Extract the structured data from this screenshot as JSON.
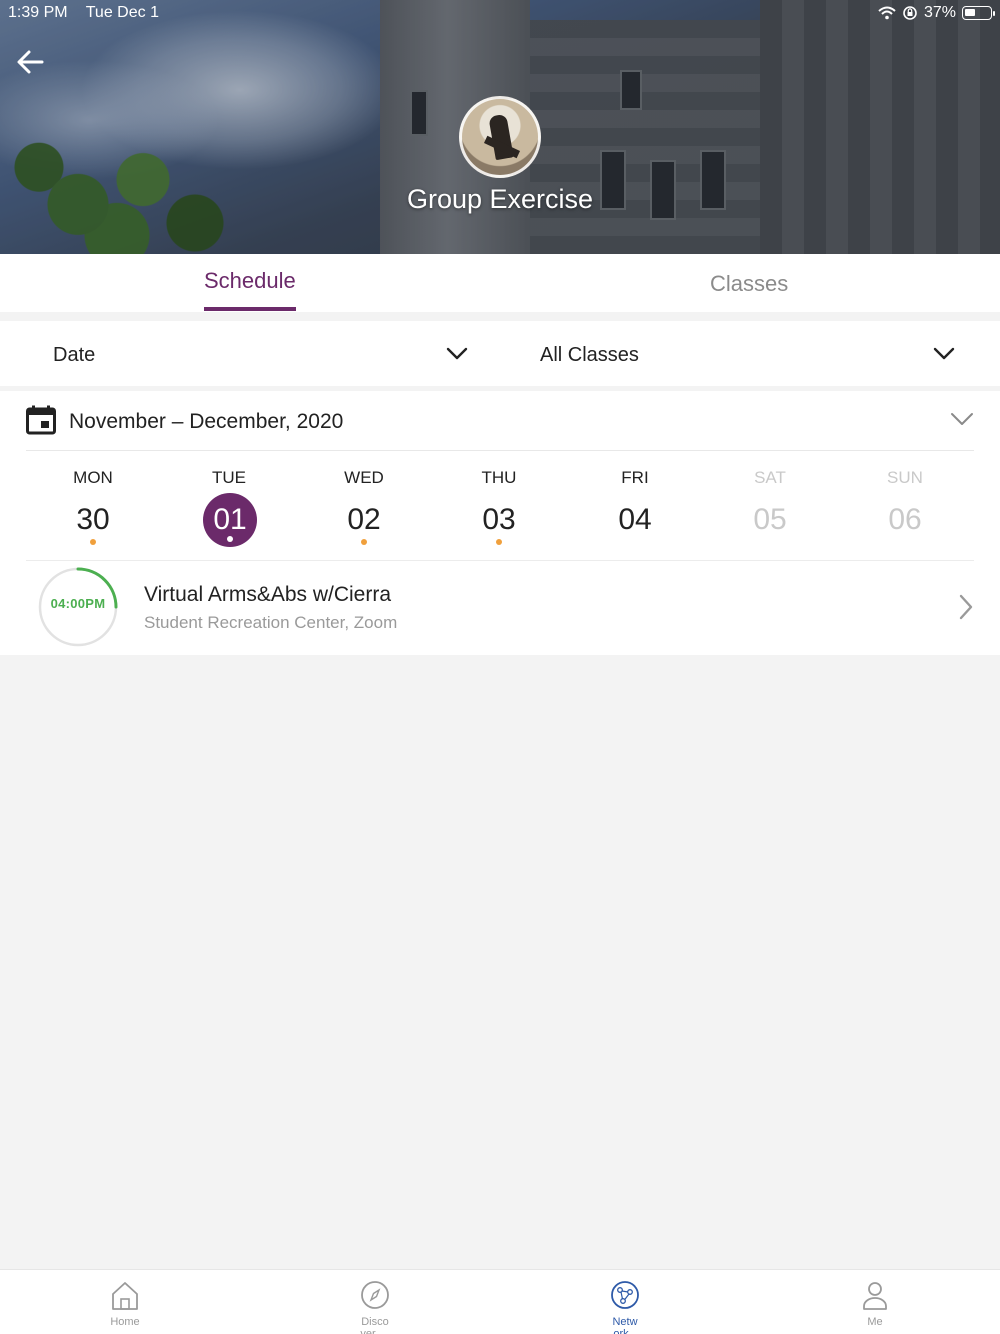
{
  "status_bar": {
    "time": "1:39 PM",
    "date": "Tue Dec 1",
    "battery": "37%"
  },
  "header": {
    "title": "Group Exercise"
  },
  "tabs": [
    {
      "label": "Schedule",
      "active": true
    },
    {
      "label": "Classes",
      "active": false
    }
  ],
  "filters": {
    "date_label": "Date",
    "class_label": "All Classes"
  },
  "calendar": {
    "range": "November – December,  2020",
    "days": [
      {
        "dow": "MON",
        "num": "30",
        "dot": true,
        "muted": false
      },
      {
        "dow": "TUE",
        "num": "01",
        "dot": true,
        "muted": false,
        "selected": true
      },
      {
        "dow": "WED",
        "num": "02",
        "dot": true,
        "muted": false
      },
      {
        "dow": "THU",
        "num": "03",
        "dot": true,
        "muted": false
      },
      {
        "dow": "FRI",
        "num": "04",
        "dot": false,
        "muted": false
      },
      {
        "dow": "SAT",
        "num": "05",
        "dot": false,
        "muted": true
      },
      {
        "dow": "SUN",
        "num": "06",
        "dot": false,
        "muted": true
      }
    ]
  },
  "event": {
    "time": "04:00PM",
    "title": "Virtual Arms&Abs w/Cierra",
    "location": "Student Recreation Center, Zoom",
    "progress": 0.25
  },
  "bottom_nav": [
    {
      "label_line1": "Home",
      "label_line2": "",
      "icon": "home-icon",
      "active": false
    },
    {
      "label_line1": "Disco",
      "label_line2": "ver",
      "icon": "compass-icon",
      "active": false
    },
    {
      "label_line1": "Netw",
      "label_line2": "ork",
      "icon": "network-icon",
      "active": true
    },
    {
      "label_line1": "Me",
      "label_line2": "",
      "icon": "person-icon",
      "active": false
    }
  ],
  "colors": {
    "accent": "#6b2a6a",
    "dot": "#f0a03c",
    "progress": "#4caf50",
    "nav_active": "#2e5aa8"
  }
}
